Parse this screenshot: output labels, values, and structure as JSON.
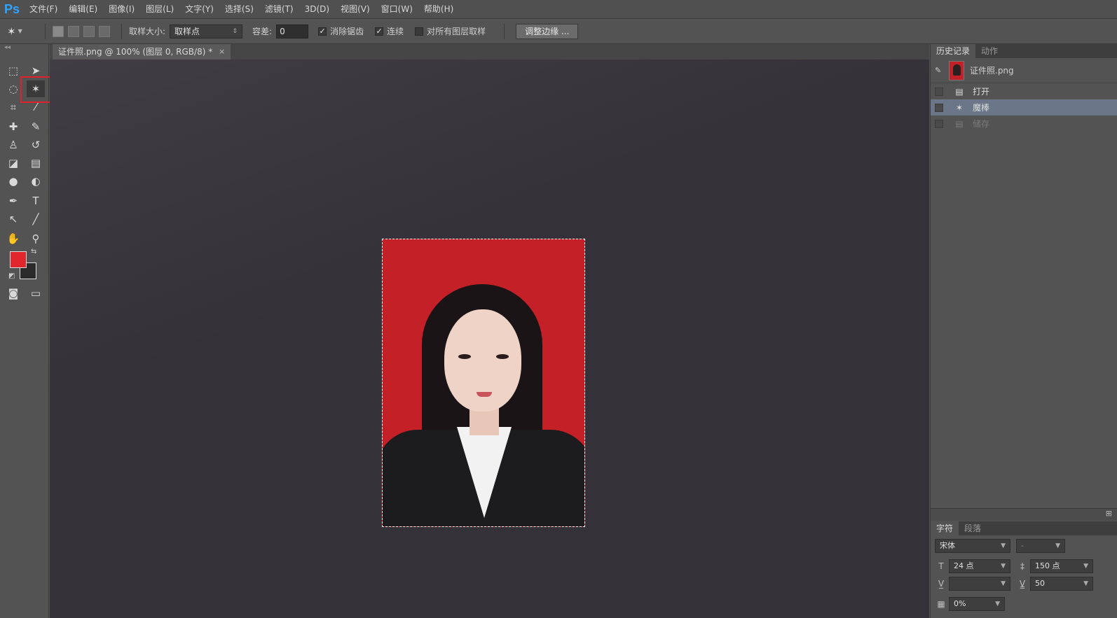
{
  "app": {
    "logo": "Ps"
  },
  "menu": [
    "文件(F)",
    "编辑(E)",
    "图像(I)",
    "图层(L)",
    "文字(Y)",
    "选择(S)",
    "滤镜(T)",
    "3D(D)",
    "视图(V)",
    "窗口(W)",
    "帮助(H)"
  ],
  "options": {
    "sample_size_label": "取样大小:",
    "sample_size_value": "取样点",
    "tolerance_label": "容差:",
    "tolerance_value": "0",
    "antialias_label": "消除锯齿",
    "contiguous_label": "连续",
    "sample_all_label": "对所有图层取样",
    "refine_edge_label": "调整边缘 ...",
    "check_mark": "✓"
  },
  "document": {
    "tab_title": "证件照.png @ 100% (图层 0, RGB/8) *",
    "close": "×"
  },
  "colors": {
    "foreground": "#e2262d",
    "background": "#2a2a2a",
    "photo_bg": "#c42028",
    "highlight": "#e2202a"
  },
  "history_panel": {
    "tabs": [
      "历史记录",
      "动作"
    ],
    "snapshot_name": "证件照.png",
    "items": [
      {
        "label": "打开",
        "icon": "document-icon"
      },
      {
        "label": "魔棒",
        "icon": "magic-wand-icon"
      },
      {
        "label": "储存",
        "icon": "document-icon"
      }
    ]
  },
  "character_panel": {
    "tabs": [
      "字符",
      "段落"
    ],
    "font_family": "宋体",
    "font_style": "-",
    "font_size": "24 点",
    "leading": "150 点",
    "kerning": "",
    "tracking": "50",
    "scale": "0%"
  }
}
